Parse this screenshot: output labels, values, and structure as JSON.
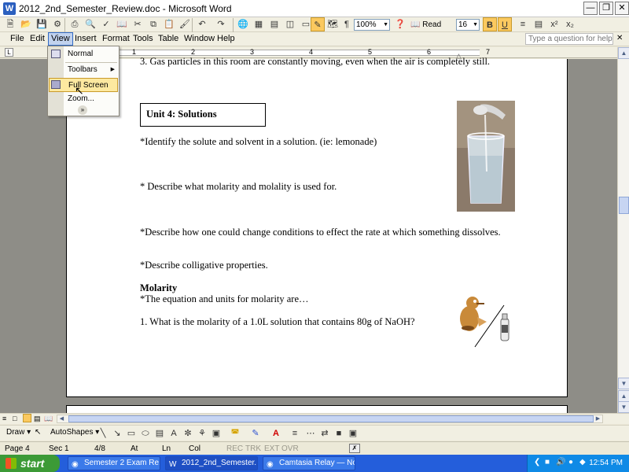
{
  "window": {
    "title": "2012_2nd_Semester_Review.doc - Microsoft Word",
    "app_icon": "word-doc-icon",
    "controls": [
      "minimize-icon",
      "maximize-icon",
      "close-icon"
    ]
  },
  "toolbar": {
    "zoom": "100%",
    "read_label": "Read",
    "font_size": "16",
    "bold": "B",
    "underline": "U"
  },
  "menubar": {
    "items": [
      "File",
      "Edit",
      "View",
      "Insert",
      "Format",
      "Tools",
      "Table",
      "Window",
      "Help"
    ],
    "help_placeholder": "Type a question for help"
  },
  "view_menu": {
    "items": [
      {
        "label": "Normal",
        "icon": "normal-view-icon"
      },
      {
        "label": "Toolbars",
        "submenu": true
      },
      {
        "label": "Full Screen",
        "icon": "full-screen-icon",
        "highlighted": true
      },
      {
        "label": "Zoom..."
      }
    ],
    "expand_icon": "chevron-double-down-icon"
  },
  "ruler": {
    "numbers": [
      "1",
      "2",
      "3",
      "4",
      "5",
      "6",
      "7"
    ]
  },
  "document": {
    "top_line": "3.  Gas particles in this room are constantly moving, even when the air is completely still.",
    "unit_heading": "Unit 4:  Solutions",
    "items": [
      "*Identify the solute and solvent in a solution. (ie: lemonade)",
      "* Describe what molarity and molality is used for.",
      "*Describe how one could change conditions to effect the rate at which something dissolves.",
      "*Describe colligative properties."
    ],
    "molarity_heading": "Molarity",
    "molarity_line": "*The equation and units for molarity are…",
    "question_1": "1. What is the molarity of a 1.0L solution that contains 80g of NaOH?"
  },
  "drawbar": {
    "draw_label": "Draw",
    "autoshapes_label": "AutoShapes"
  },
  "statusbar": {
    "page": "Page 4",
    "sec": "Sec 1",
    "pages": "4/8",
    "at": "At",
    "ln": "Ln",
    "col": "Col",
    "rec": "REC",
    "trk": "TRK",
    "ext": "EXT",
    "ovr": "OVR"
  },
  "taskbar": {
    "start_label": "start",
    "tasks": [
      {
        "label": "Semester 2 Exam Re...",
        "active": false
      },
      {
        "label": "2012_2nd_Semester...",
        "active": true
      },
      {
        "label": "Camtasia Relay — No...",
        "active": false
      }
    ],
    "clock": "12:54 PM"
  },
  "colors": {
    "taskbar": "#245edb",
    "start": "#3c9a36",
    "menu_highlight": "#fde9a0",
    "page_background": "#8e8d87"
  }
}
